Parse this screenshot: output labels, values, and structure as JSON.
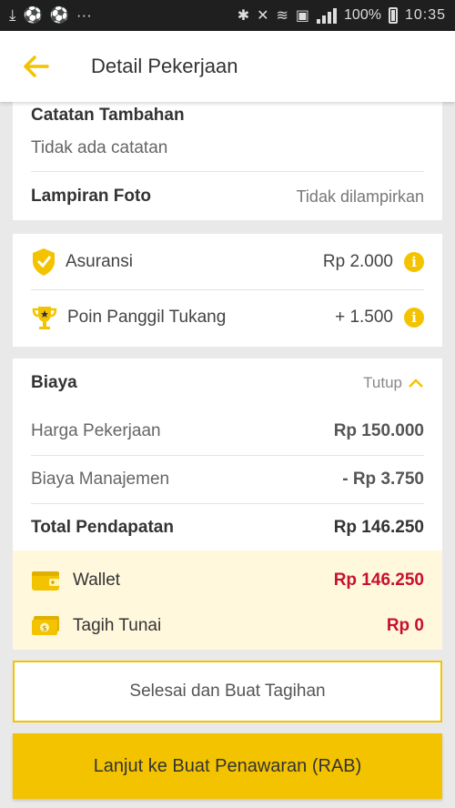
{
  "status_bar": {
    "left_icons": [
      "download-icon",
      "soccer-ball-icon",
      "soccer-ball-icon",
      "more-icon"
    ],
    "battery_text": "100%",
    "time": "10:35"
  },
  "header": {
    "title": "Detail Pekerjaan"
  },
  "notes_card": {
    "catatan_label": "Catatan Tambahan",
    "catatan_value": "Tidak ada catatan",
    "lampiran_label": "Lampiran Foto",
    "lampiran_value": "Tidak dilampirkan"
  },
  "extras_card": {
    "asuransi_label": "Asuransi",
    "asuransi_value": "Rp 2.000",
    "poin_label": "Poin Panggil Tukang",
    "poin_value": "+ 1.500"
  },
  "cost_card": {
    "title": "Biaya",
    "toggle_label": "Tutup",
    "rows": [
      {
        "label": "Harga Pekerjaan",
        "value": "Rp 150.000"
      },
      {
        "label": "Biaya Manajemen",
        "value": "- Rp 3.750"
      }
    ],
    "total_label": "Total Pendapatan",
    "total_value": "Rp 146.250",
    "wallet_label": "Wallet",
    "wallet_value": "Rp 146.250",
    "cash_label": "Tagih Tunai",
    "cash_value": "Rp 0"
  },
  "buttons": {
    "secondary": "Selesai dan Buat Tagihan",
    "primary": "Lanjut ke Buat Penawaran (RAB)"
  },
  "colors": {
    "accent": "#f4c300",
    "negative": "#c8102e",
    "highlight_bg": "#fff8dd"
  }
}
